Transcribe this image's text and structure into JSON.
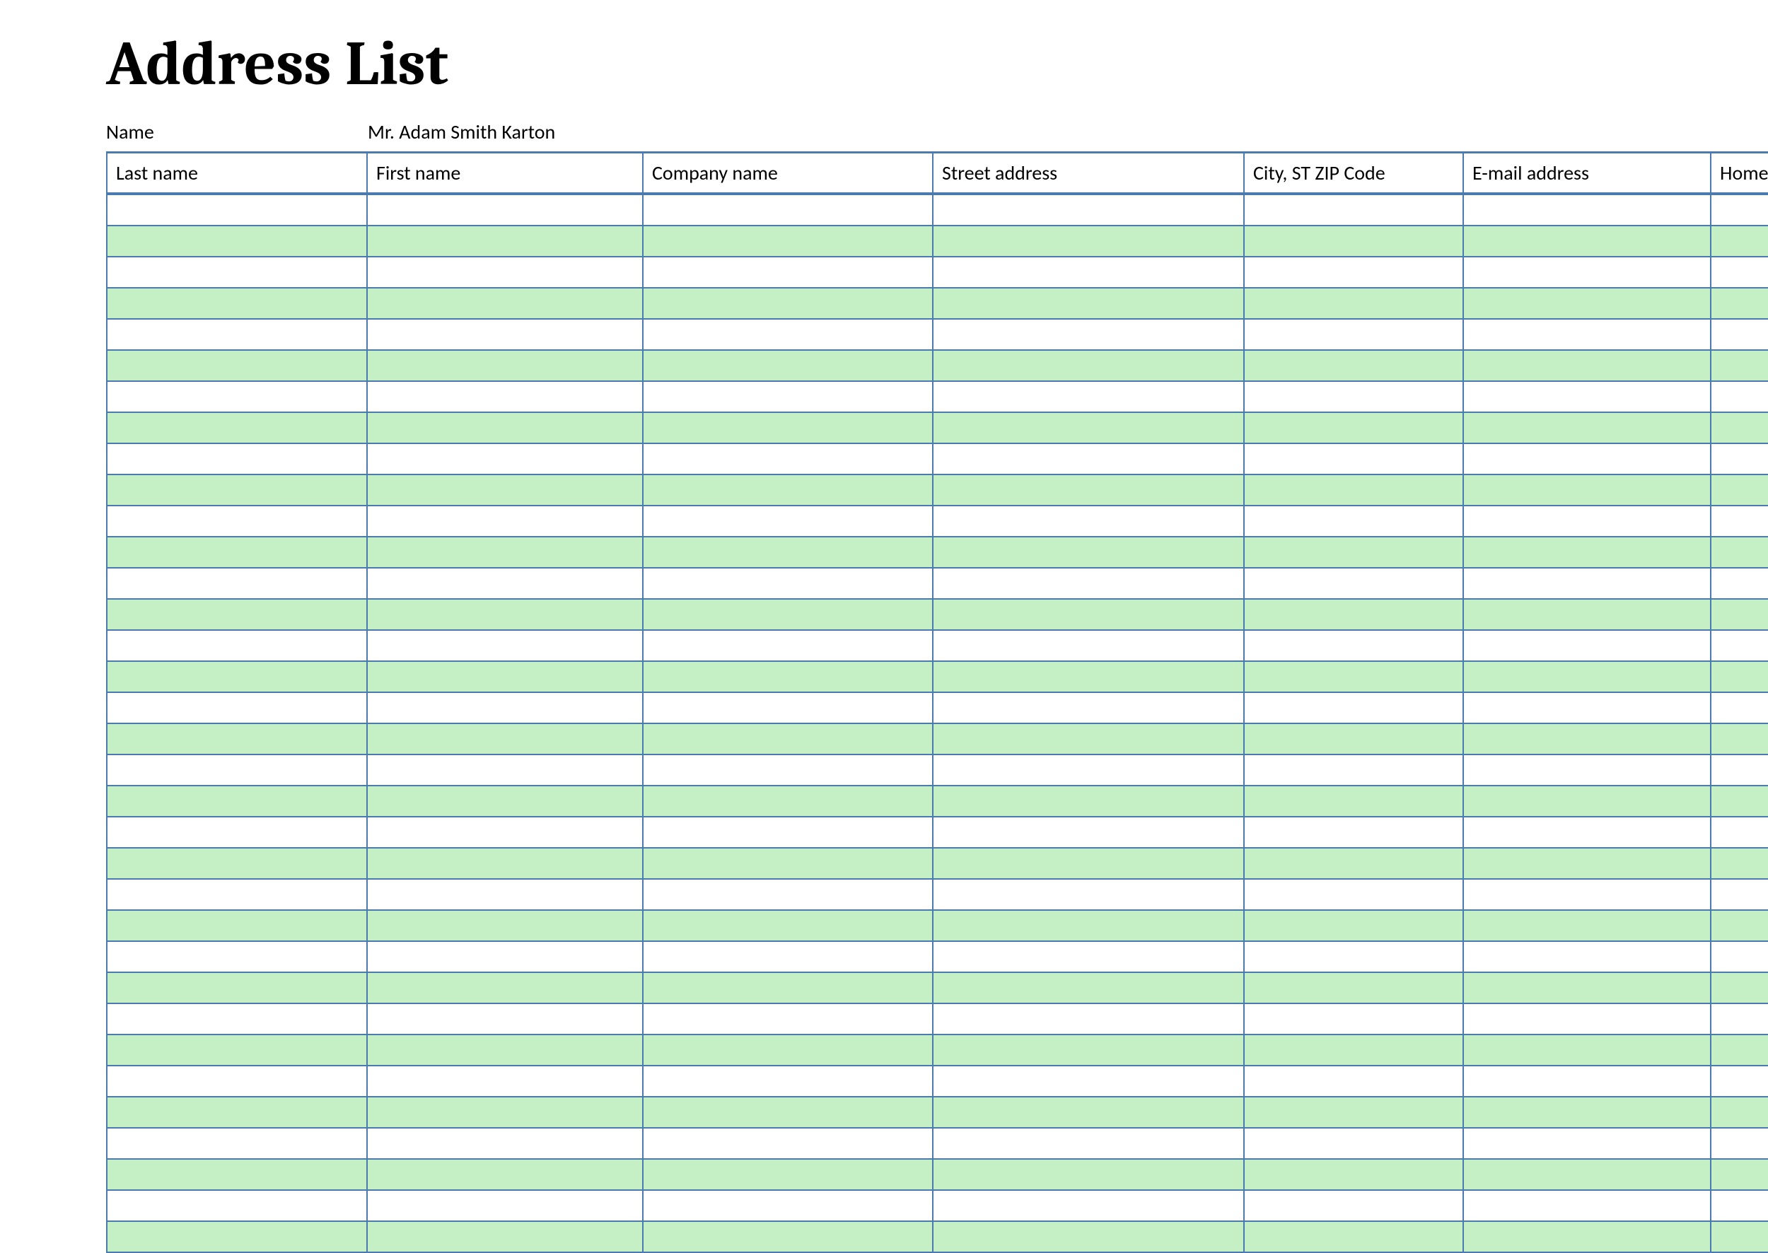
{
  "title": "Address List",
  "name_label": "Name",
  "name_value": "Mr. Adam Smith Karton",
  "columns": [
    "Last name",
    "First name",
    "Company name",
    "Street address",
    "City, ST  ZIP Code",
    "E-mail address",
    "Home"
  ],
  "row_count": 34,
  "colors": {
    "border": "#4a7ab0",
    "row_alt": "#c5f0c5",
    "row_base": "#ffffff"
  }
}
